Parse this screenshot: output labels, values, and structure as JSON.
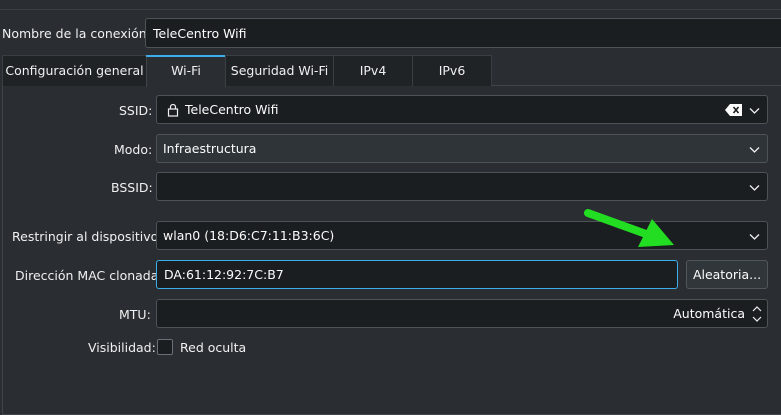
{
  "connection": {
    "name_label": "Nombre de la conexión:",
    "name_value": "TeleCentro Wifi"
  },
  "tabs": [
    {
      "label": "Configuración general",
      "active": false
    },
    {
      "label": "Wi-Fi",
      "active": true
    },
    {
      "label": "Seguridad Wi-Fi",
      "active": false
    },
    {
      "label": "IPv4",
      "active": false
    },
    {
      "label": "IPv6",
      "active": false
    }
  ],
  "form": {
    "ssid_label": "SSID:",
    "ssid_value": "TeleCentro Wifi",
    "mode_label": "Modo:",
    "mode_value": "Infraestructura",
    "bssid_label": "BSSID:",
    "bssid_value": "",
    "restrict_label": "Restringir al dispositivo:",
    "restrict_value": "wlan0 (18:D6:C7:11:B3:6C)",
    "mac_label": "Dirección MAC clonada:",
    "mac_value": "DA:61:12:92:7C:B7",
    "random_button": "Aleatoria...",
    "mtu_label": "MTU:",
    "mtu_value": "Automática",
    "visibility_label": "Visibilidad:",
    "hidden_label": "Red oculta",
    "hidden_checked": false
  },
  "annotation": {
    "arrow_color": "#22dd22"
  },
  "colors": {
    "accent": "#3daee9",
    "field_bg": "#1b1e20",
    "window_bg": "#2a2e32"
  }
}
